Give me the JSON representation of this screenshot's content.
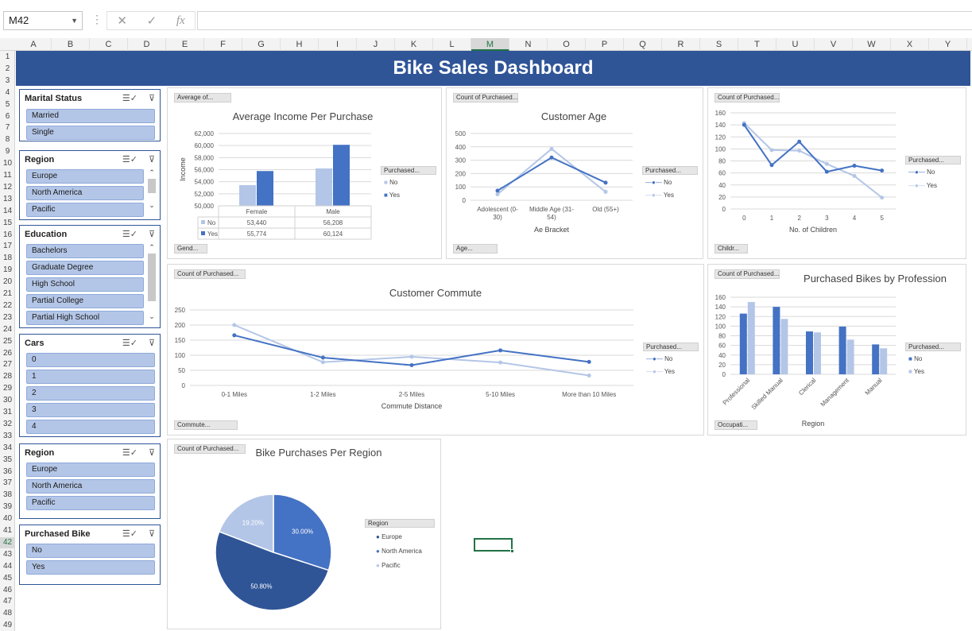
{
  "namebox": {
    "value": "M42"
  },
  "formula": {
    "cancel": "✕",
    "confirm": "✓",
    "fx": "fx",
    "content": ""
  },
  "columns": [
    "A",
    "B",
    "C",
    "D",
    "E",
    "F",
    "G",
    "H",
    "I",
    "J",
    "K",
    "L",
    "M",
    "N",
    "O",
    "P",
    "Q",
    "R",
    "S",
    "T",
    "U",
    "V",
    "W",
    "X",
    "Y"
  ],
  "selected_column": "M",
  "rows": [
    "1",
    "2",
    "3",
    "4",
    "5",
    "6",
    "7",
    "8",
    "9",
    "10",
    "11",
    "12",
    "13",
    "14",
    "15",
    "16",
    "17",
    "18",
    "19",
    "20",
    "21",
    "22",
    "23",
    "24",
    "25",
    "26",
    "27",
    "28",
    "29",
    "30",
    "31",
    "32",
    "33",
    "34",
    "35",
    "36",
    "37",
    "38",
    "39",
    "40",
    "41",
    "42",
    "43",
    "44",
    "45",
    "46",
    "47",
    "48",
    "49"
  ],
  "selected_row": "42",
  "banner": {
    "title": "Bike Sales Dashboard"
  },
  "slicers": {
    "marital": {
      "title": "Marital Status",
      "items": [
        "Married",
        "Single"
      ]
    },
    "region1": {
      "title": "Region",
      "items": [
        "Europe",
        "North America",
        "Pacific"
      ]
    },
    "education": {
      "title": "Education",
      "items": [
        "Bachelors",
        "Graduate Degree",
        "High School",
        "Partial College",
        "Partial High School"
      ]
    },
    "cars": {
      "title": "Cars",
      "items": [
        "0",
        "1",
        "2",
        "3",
        "4"
      ]
    },
    "region2": {
      "title": "Region",
      "items": [
        "Europe",
        "North America",
        "Pacific"
      ]
    },
    "purchased": {
      "title": "Purchased Bike",
      "items": [
        "No",
        "Yes"
      ]
    }
  },
  "colors": {
    "dark": "#4472c4",
    "light": "#b4c6e7",
    "navy": "#2f5597",
    "pie_dark": "#2f5597",
    "pie_mid": "#4472c4",
    "pie_light": "#b4c6e7"
  },
  "charts": {
    "income": {
      "field_btn": "Average of...",
      "axis_btn": "Gend...",
      "legend_btn": "Purchased...",
      "legend": [
        "No",
        "Yes"
      ]
    },
    "age": {
      "field_btn": "Count of Purchased...",
      "axis_btn": "Age...",
      "legend_btn": "Purchased...",
      "legend": [
        "No",
        "Yes"
      ]
    },
    "children": {
      "field_btn": "Count of Purchased...",
      "axis_btn": "Childr...",
      "legend_btn": "Purchased...",
      "legend": [
        "No",
        "Yes"
      ]
    },
    "commute": {
      "field_btn": "Count of Purchased...",
      "axis_btn": "Commute...",
      "legend_btn": "Purchased...",
      "legend": [
        "No",
        "Yes"
      ]
    },
    "profession": {
      "field_btn": "Count of Purchased...",
      "axis_btn": "Occupati...",
      "legend_btn": "Purchased...",
      "legend": [
        "No",
        "Yes"
      ]
    },
    "region": {
      "field_btn": "Count of Purchased...",
      "legend_btn": "Region",
      "legend": [
        "Europe",
        "North America",
        "Pacific"
      ]
    }
  },
  "chart_data": [
    {
      "type": "bar",
      "title": "Average Income Per Purchase",
      "ylabel": "Income",
      "xlabel": "",
      "categories": [
        "Female",
        "Male"
      ],
      "series": [
        {
          "name": "No",
          "values": [
            53440,
            56208
          ]
        },
        {
          "name": "Yes",
          "values": [
            55774,
            60124
          ]
        }
      ],
      "ylim": [
        50000,
        62000
      ],
      "yticks": [
        "50,000",
        "52,000",
        "54,000",
        "56,000",
        "58,000",
        "60,000",
        "62,000"
      ],
      "table": [
        [
          "No",
          "53,440",
          "56,208"
        ],
        [
          "Yes",
          "55,774",
          "60,124"
        ]
      ],
      "legend": "right"
    },
    {
      "type": "line",
      "title": "Customer Age",
      "xlabel": "Ae Bracket",
      "ylabel": "",
      "categories": [
        "Adolescent (0-30)",
        "Middle Age (31-54)",
        "Old (55+)"
      ],
      "series": [
        {
          "name": "No",
          "values": [
            72,
            320,
            132
          ]
        },
        {
          "name": "Yes",
          "values": [
            45,
            385,
            63
          ]
        }
      ],
      "ylim": [
        0,
        500
      ],
      "yticks": [
        "0",
        "100",
        "200",
        "300",
        "400",
        "500"
      ],
      "legend": "right"
    },
    {
      "type": "line",
      "title": "",
      "xlabel": "No. of Children",
      "ylabel": "",
      "categories": [
        "0",
        "1",
        "2",
        "3",
        "4",
        "5"
      ],
      "series": [
        {
          "name": "No",
          "values": [
            140,
            73,
            112,
            62,
            72,
            64
          ]
        },
        {
          "name": "Yes",
          "values": [
            143,
            98,
            97,
            75,
            55,
            19
          ]
        }
      ],
      "ylim": [
        0,
        160
      ],
      "yticks": [
        "0",
        "20",
        "40",
        "60",
        "80",
        "100",
        "120",
        "140",
        "160"
      ],
      "legend": "right"
    },
    {
      "type": "line",
      "title": "Customer Commute",
      "xlabel": "Commute Distance",
      "ylabel": "",
      "categories": [
        "0-1 Miles",
        "1-2 Miles",
        "2-5 Miles",
        "5-10 Miles",
        "More than 10 Miles"
      ],
      "series": [
        {
          "name": "No",
          "values": [
            166,
            92,
            67,
            116,
            78
          ]
        },
        {
          "name": "Yes",
          "values": [
            200,
            77,
            95,
            76,
            33
          ]
        }
      ],
      "ylim": [
        0,
        250
      ],
      "yticks": [
        "0",
        "50",
        "100",
        "150",
        "200",
        "250"
      ],
      "legend": "right"
    },
    {
      "type": "bar",
      "title": "Purchased Bikes by Profession",
      "xlabel": "Region",
      "ylabel": "",
      "categories": [
        "Professional",
        "Skilled Manual",
        "Clerical",
        "Management",
        "Manual"
      ],
      "series": [
        {
          "name": "No",
          "values": [
            126,
            140,
            89,
            99,
            62
          ]
        },
        {
          "name": "Yes",
          "values": [
            150,
            115,
            87,
            72,
            54
          ]
        }
      ],
      "ylim": [
        0,
        160
      ],
      "yticks": [
        "0",
        "20",
        "40",
        "60",
        "80",
        "100",
        "120",
        "140",
        "160"
      ],
      "legend": "right"
    },
    {
      "type": "pie",
      "title": "Bike Purchases Per Region",
      "categories": [
        "Europe",
        "North America",
        "Pacific"
      ],
      "values": [
        30.0,
        50.8,
        19.2
      ],
      "labels": [
        "30.00%",
        "50.80%",
        "19.20%"
      ],
      "legend": "right"
    }
  ]
}
